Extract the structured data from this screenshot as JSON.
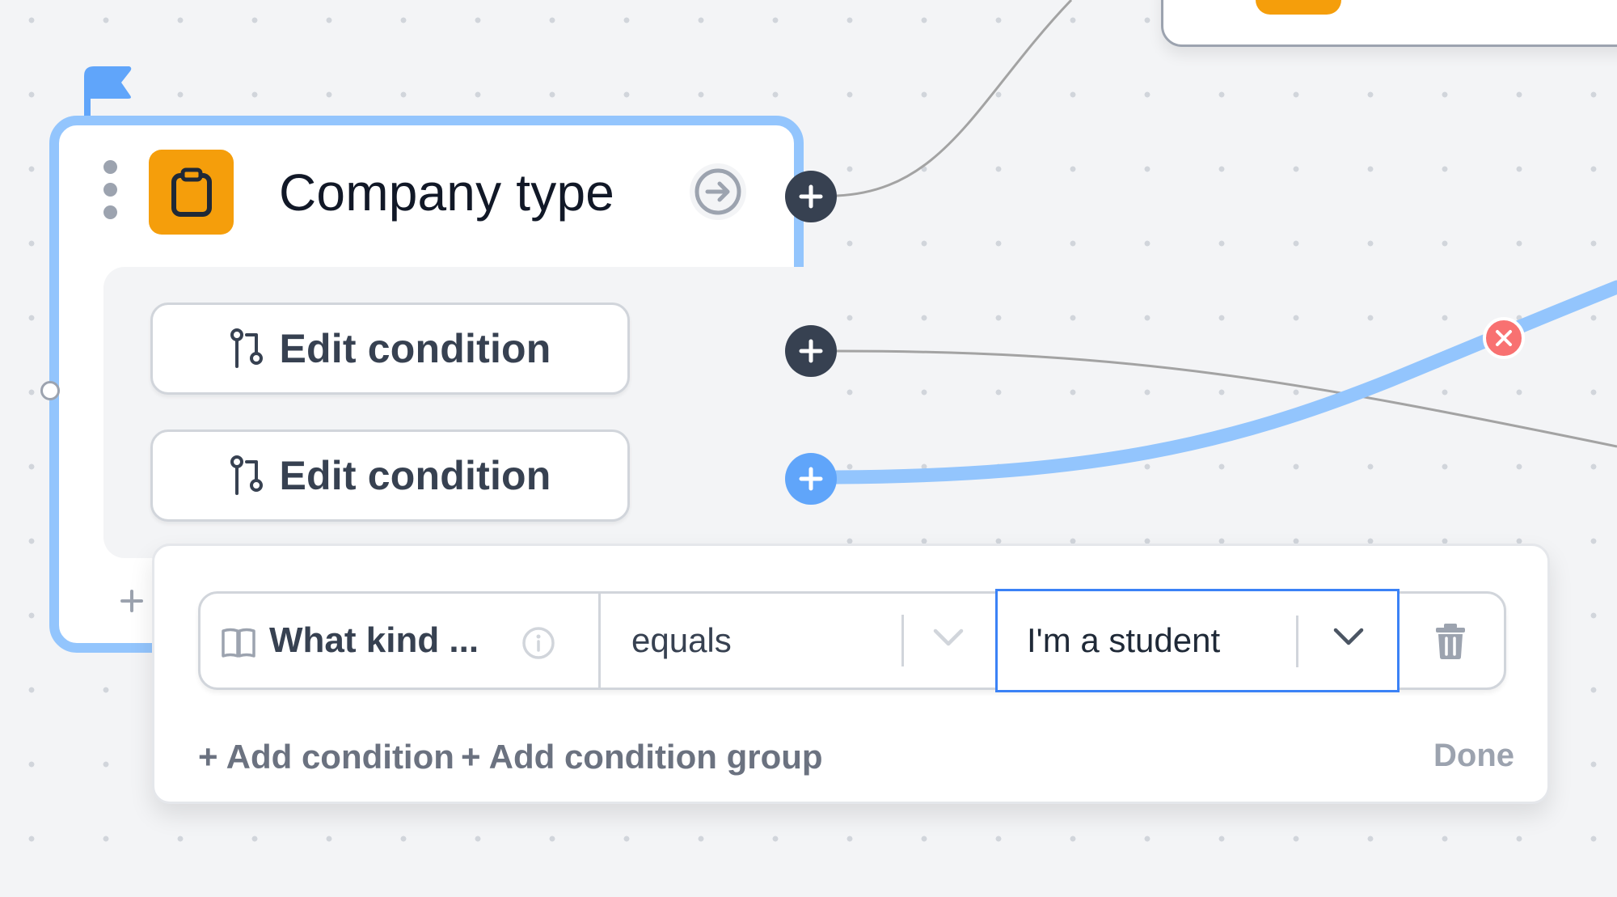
{
  "node": {
    "title": "Company type",
    "icon": "clipboard-icon",
    "accent_color": "#f59e0b",
    "selected_border_color": "#93c5fd",
    "start_flag_color": "#60a5fa",
    "conditions": [
      {
        "label": "Edit condition",
        "icon": "branch-icon"
      },
      {
        "label": "Edit condition",
        "icon": "branch-icon"
      }
    ]
  },
  "condition_editor": {
    "field": {
      "label": "What kind ...",
      "icon": "book-icon",
      "info_icon": "info-icon"
    },
    "operator": {
      "value": "equals"
    },
    "value": {
      "value": "I'm a student",
      "focused": true
    },
    "add_condition_label": "+ Add condition",
    "add_condition_group_label": "+ Add condition group",
    "done_label": "Done",
    "focus_color": "#3b82f6"
  },
  "edges": {
    "highlight_color": "#93c5fd",
    "default_color": "#a3a3a3",
    "delete_color": "#f87171"
  }
}
